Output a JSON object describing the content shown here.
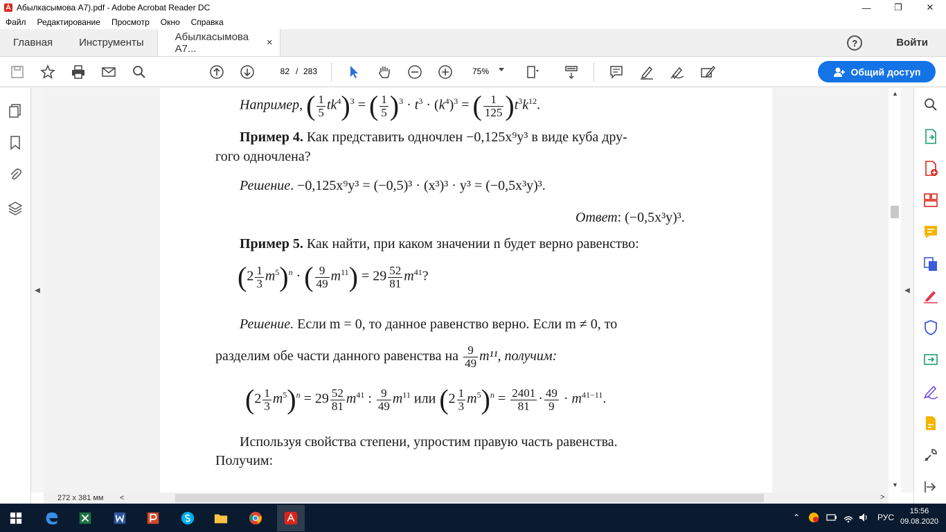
{
  "window": {
    "title": "Абылкасымова А7).pdf - Adobe Acrobat Reader DC",
    "minimize": "—",
    "restore": "❐",
    "close": "✕"
  },
  "menu": [
    "Файл",
    "Редактирование",
    "Просмотр",
    "Окно",
    "Справка"
  ],
  "tabs": {
    "home": "Главная",
    "tools": "Инструменты",
    "document": "Абылкасымова А7...",
    "doc_close": "×",
    "help": "?",
    "signin": "Войти"
  },
  "toolbar": {
    "page_current": "82",
    "page_sep": "/",
    "page_total": "283",
    "zoom": "75%",
    "share_label": "Общий доступ"
  },
  "document": {
    "line1_prefix": "Например,",
    "ex4_bold": "Пример 4.",
    "ex4_text": " Как представить одночлен −0,125x⁹y³ в виде куба дру-",
    "ex4_text2": "гого одночлена?",
    "solution_label": "Решение",
    "sol4_text": ". −0,125x⁹y³ = (−0,5)³ · (x³)³ · y³ = (−0,5x³y)³.",
    "answer_label": "Ответ",
    "answer_text": ": (−0,5x³y)³.",
    "ex5_bold": "Пример 5.",
    "ex5_text": " Как найти, при каком значении n будет верно равенство:",
    "sol5_label": "Решение.",
    "sol5_text": " Если m = 0, то данное равенство верно. Если m ≠ 0, то",
    "divide_text": "разделим обе части данного равенства на",
    "divide_tail": "m¹¹, получим:",
    "props_text": "Используя свойства степени, упростим правую часть равенства.",
    "get_text": "Получим:"
  },
  "status": {
    "dimensions": "272 x 381 мм",
    "left_arrow": "<",
    "right_arrow": ">"
  },
  "taskbar": {
    "lang": "РУС",
    "time": "15:56",
    "date": "09.08.2020"
  },
  "colors": {
    "accent": "#1473e6",
    "taskbar": "#0a1a2f",
    "rail_icon": "#c8102e"
  }
}
